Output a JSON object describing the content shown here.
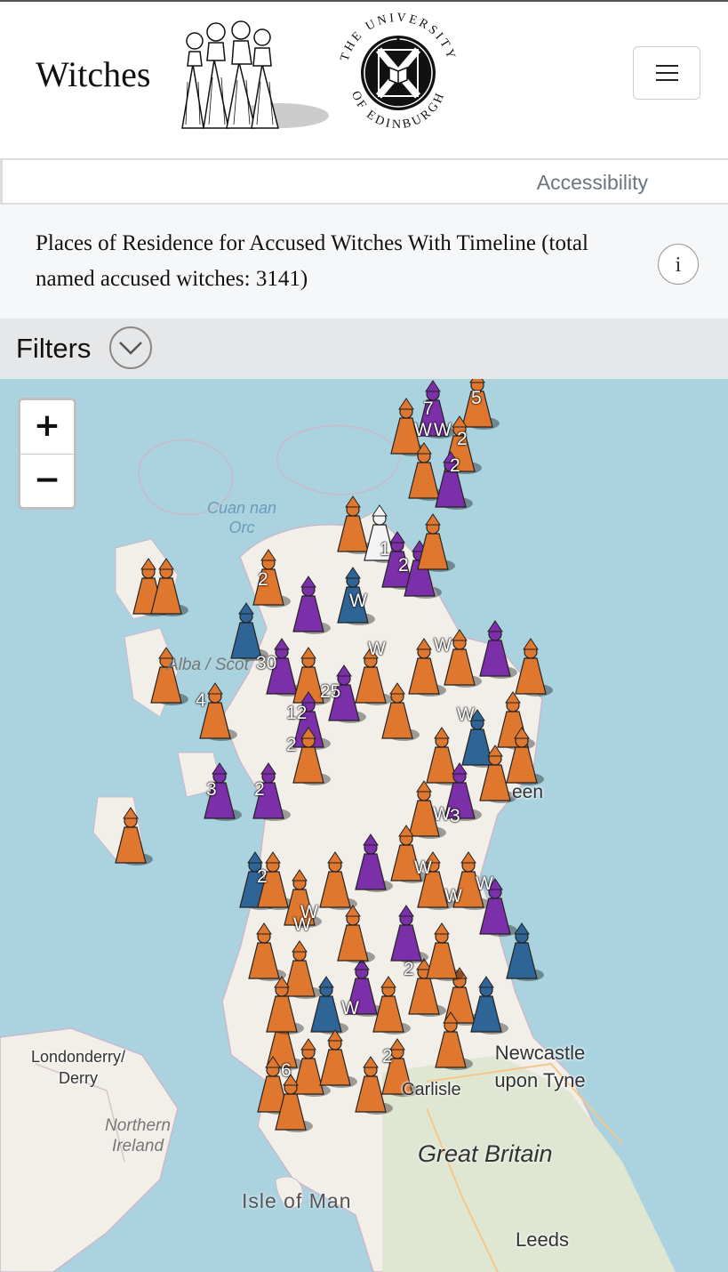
{
  "header": {
    "brand": "Witches",
    "university_name_top": "THE UNIVERSITY",
    "university_name_bottom": "OF EDINBURGH",
    "menu_icon": "hamburger-icon"
  },
  "nav": {
    "accessibility_label": "Accessibility"
  },
  "page": {
    "title": "Places of Residence for Accused Witches With Timeline (total named accused witches: 3141)",
    "info_icon": "i"
  },
  "filters": {
    "label": "Filters",
    "toggle_icon": "chevron-down-icon"
  },
  "map": {
    "zoom_in": "+",
    "zoom_out": "−",
    "labels": {
      "sea": "Cuan nan Orc",
      "alba": "Alba / Scot",
      "aberdeen_fragment": "een",
      "londonderry": "Londonderry/ Derry",
      "northern_ireland": "Northern Ireland",
      "newcastle": "Newcastle upon Tyne",
      "carlisle": "Carlisle",
      "great_britain": "Great Britain",
      "isle_of_man": "Isle of Man",
      "leeds": "Leeds"
    },
    "cluster_counts": {
      "c7": "7",
      "c5": "5",
      "c2a": "2",
      "cW1": "W",
      "cW2": "W",
      "c2b": "2",
      "c1": "1",
      "c2c": "2",
      "c2d": "2",
      "cW3": "W",
      "c30": "30",
      "c25": "25",
      "cW4": "W",
      "c4": "4",
      "c12": "12",
      "c2e": "2",
      "cW5": "W",
      "cW6": "W",
      "c3": "3",
      "c2f": "2",
      "cW7": "W",
      "cW8": "W",
      "c2g": "2",
      "cW9": "W",
      "cW10": "W",
      "cW11": "W",
      "c2h": "2",
      "cW12": "W",
      "c6": "6",
      "c2i": "2",
      "c3b": "3",
      "cW13": "W"
    },
    "colors": {
      "orange": "#e0772f",
      "purple": "#7b2fa8",
      "blue": "#2f6496",
      "white": "#f4f4f4"
    }
  }
}
